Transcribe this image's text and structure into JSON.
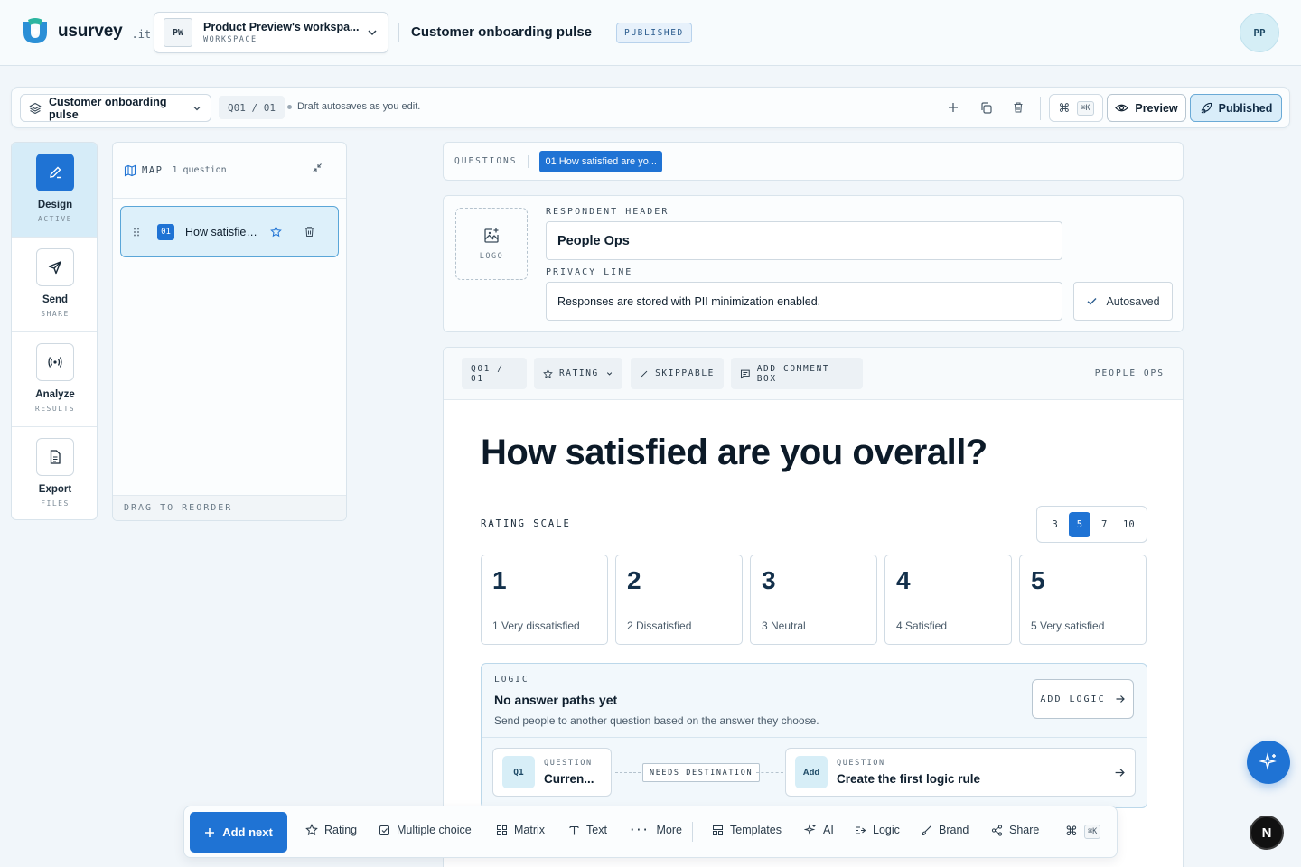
{
  "brand": {
    "name": "usurvey",
    "tld": ".it"
  },
  "workspace": {
    "initials": "PW",
    "name": "Product Preview's workspa...",
    "sub": "WORKSPACE"
  },
  "header": {
    "title": "Customer onboarding pulse",
    "status": "PUBLISHED",
    "user_initials": "PP"
  },
  "toolbar": {
    "survey_name": "Customer onboarding pulse",
    "q_position": "Q01 / 01",
    "autosave_note": "Draft autosaves as you edit.",
    "shortcut": "⌘K",
    "preview_label": "Preview",
    "published_label": "Published"
  },
  "rail": {
    "items": [
      {
        "label": "Design",
        "sub": "ACTIVE"
      },
      {
        "label": "Send",
        "sub": "SHARE"
      },
      {
        "label": "Analyze",
        "sub": "RESULTS"
      },
      {
        "label": "Export",
        "sub": "FILES"
      }
    ]
  },
  "map": {
    "title": "MAP",
    "count": "1 question",
    "item_num": "01",
    "item_title": "How satisfied are you overall?",
    "footer": "DRAG TO REORDER"
  },
  "questions_strip": {
    "label": "QUESTIONS",
    "chip": "01 How satisfied are yo..."
  },
  "respondent": {
    "logo_label": "LOGO",
    "header_label": "RESPONDENT HEADER",
    "header_value": "People Ops",
    "privacy_label": "PRIVACY LINE",
    "privacy_value": "Responses are stored with PII minimization enabled.",
    "autosaved_label": "Autosaved"
  },
  "question": {
    "position": "Q01 / 01",
    "type": "RATING",
    "skippable": "SKIPPABLE",
    "comment": "ADD COMMENT BOX",
    "owner": "PEOPLE OPS",
    "title": "How satisfied are you overall?",
    "scale_label": "RATING SCALE",
    "scale_options": [
      "3",
      "5",
      "7",
      "10"
    ],
    "scale_selected": "5",
    "options": [
      {
        "num": "1",
        "label": "1 Very dissatisfied"
      },
      {
        "num": "2",
        "label": "2 Dissatisfied"
      },
      {
        "num": "3",
        "label": "3 Neutral"
      },
      {
        "num": "4",
        "label": "4 Satisfied"
      },
      {
        "num": "5",
        "label": "5 Very satisfied"
      }
    ]
  },
  "logic": {
    "cap": "LOGIC",
    "heading": "No answer paths yet",
    "sub": "Send people to another question based on the answer they choose.",
    "add_label": "ADD LOGIC",
    "from_badge": "Q1",
    "from_cap": "QUESTION",
    "from_title": "Curren...",
    "needs": "NEEDS DESTINATION",
    "to_badge": "Add",
    "to_cap": "QUESTION",
    "to_title": "Create the first logic rule"
  },
  "bottom": {
    "add_next": "Add next",
    "items": [
      "Rating",
      "Multiple choice",
      "Matrix",
      "Text",
      "More",
      "Templates",
      "AI",
      "Logic",
      "Brand",
      "Share"
    ],
    "shortcut": "⌘K"
  },
  "fab_n": "N"
}
